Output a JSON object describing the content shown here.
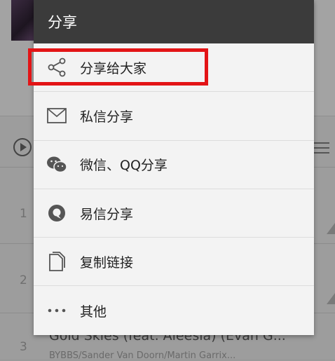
{
  "dialog": {
    "title": "分享",
    "items": [
      {
        "label": "分享给大家",
        "icon": "share-icon"
      },
      {
        "label": "私信分享",
        "icon": "mail-icon"
      },
      {
        "label": "微信、QQ分享",
        "icon": "wechat-icon"
      },
      {
        "label": "易信分享",
        "icon": "yixin-icon"
      },
      {
        "label": "复制链接",
        "icon": "copy-icon"
      },
      {
        "label": "其他",
        "icon": "more-icon"
      }
    ],
    "highlight_color": "#e31416"
  },
  "background": {
    "track_numbers": [
      "1",
      "2",
      "3"
    ],
    "song_title": "Gold Skies (feat. Aleesia) (Evan G...",
    "song_subtitle": "BYBBS/Sander Van Doorn/Martin Garrix..."
  }
}
